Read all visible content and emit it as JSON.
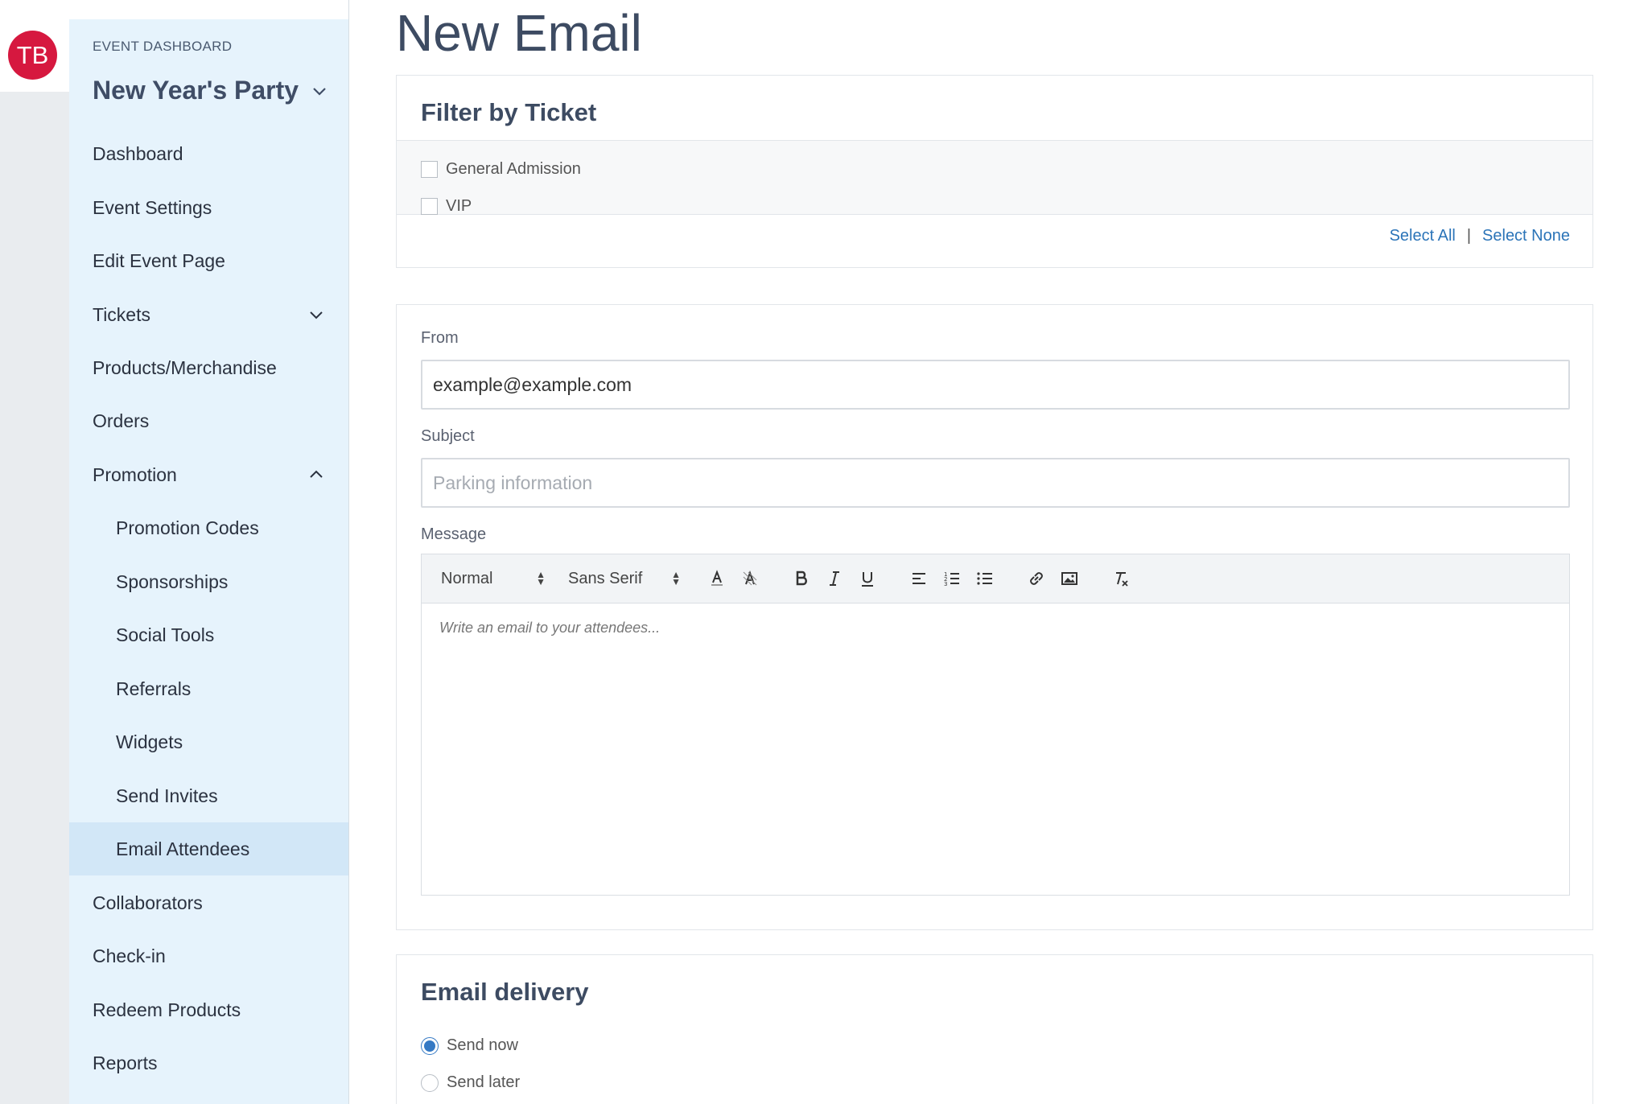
{
  "user": {
    "initials": "TB"
  },
  "sidebar": {
    "section_label": "EVENT DASHBOARD",
    "event_name": "New Year's Party",
    "items": [
      {
        "label": "Dashboard"
      },
      {
        "label": "Event Settings"
      },
      {
        "label": "Edit Event Page"
      },
      {
        "label": "Tickets"
      },
      {
        "label": "Products/Merchandise"
      },
      {
        "label": "Orders"
      },
      {
        "label": "Promotion"
      },
      {
        "label": "Promotion Codes"
      },
      {
        "label": "Sponsorships"
      },
      {
        "label": "Social Tools"
      },
      {
        "label": "Referrals"
      },
      {
        "label": "Widgets"
      },
      {
        "label": "Send Invites"
      },
      {
        "label": "Email Attendees"
      },
      {
        "label": "Collaborators"
      },
      {
        "label": "Check-in"
      },
      {
        "label": "Redeem Products"
      },
      {
        "label": "Reports"
      }
    ]
  },
  "page": {
    "title": "New Email"
  },
  "filter": {
    "title": "Filter by Ticket",
    "options": [
      {
        "label": "General Admission"
      },
      {
        "label": "VIP"
      }
    ],
    "select_all": "Select All",
    "separator": "|",
    "select_none": "Select None"
  },
  "form": {
    "from_label": "From",
    "from_value": "example@example.com",
    "subject_label": "Subject",
    "subject_placeholder": "Parking information",
    "message_label": "Message",
    "toolbar": {
      "size": "Normal",
      "font": "Sans Serif"
    },
    "message_placeholder": "Write an email to your attendees..."
  },
  "delivery": {
    "title": "Email delivery",
    "options": [
      {
        "label": "Send now",
        "selected": true
      },
      {
        "label": "Send later",
        "selected": false
      }
    ]
  },
  "colors": {
    "accent": "#3479c4",
    "avatar": "#d6183f",
    "sidebar_bg": "#e6f3fc",
    "link": "#2b74b8"
  }
}
